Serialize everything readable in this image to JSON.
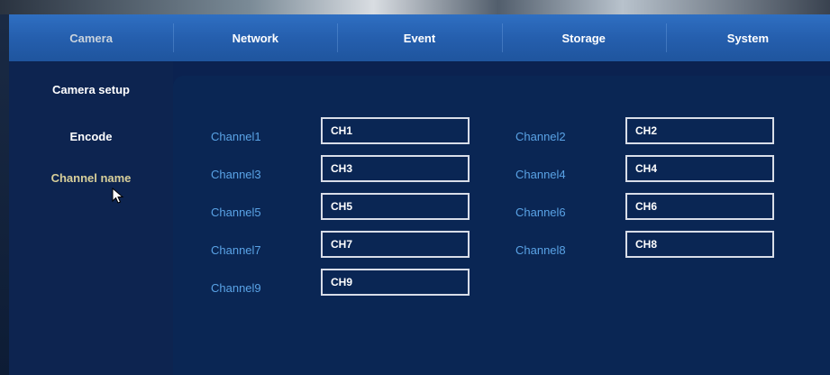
{
  "tabs": [
    {
      "label": "Camera",
      "active": true
    },
    {
      "label": "Network",
      "active": false
    },
    {
      "label": "Event",
      "active": false
    },
    {
      "label": "Storage",
      "active": false
    },
    {
      "label": "System",
      "active": false
    }
  ],
  "sidebar": {
    "items": [
      {
        "label": "Camera setup",
        "active": false
      },
      {
        "label": "Encode",
        "active": false
      },
      {
        "label": "Channel name",
        "active": true
      }
    ]
  },
  "channels": [
    {
      "label": "Channel1",
      "value": "CH1"
    },
    {
      "label": "Channel2",
      "value": "CH2"
    },
    {
      "label": "Channel3",
      "value": "CH3"
    },
    {
      "label": "Channel4",
      "value": "CH4"
    },
    {
      "label": "Channel5",
      "value": "CH5"
    },
    {
      "label": "Channel6",
      "value": "CH6"
    },
    {
      "label": "Channel7",
      "value": "CH7"
    },
    {
      "label": "Channel8",
      "value": "CH8"
    },
    {
      "label": "Channel9",
      "value": "CH9"
    }
  ],
  "colors": {
    "tab_bar": "#2a65b5",
    "background": "#0b2250",
    "panel": "#0a2654",
    "channel_label": "#5aa3e6",
    "active_sidebar_text": "#d8cf9a",
    "input_border": "#d8dde8"
  },
  "icons": {
    "cursor": "mouse-pointer-icon"
  }
}
